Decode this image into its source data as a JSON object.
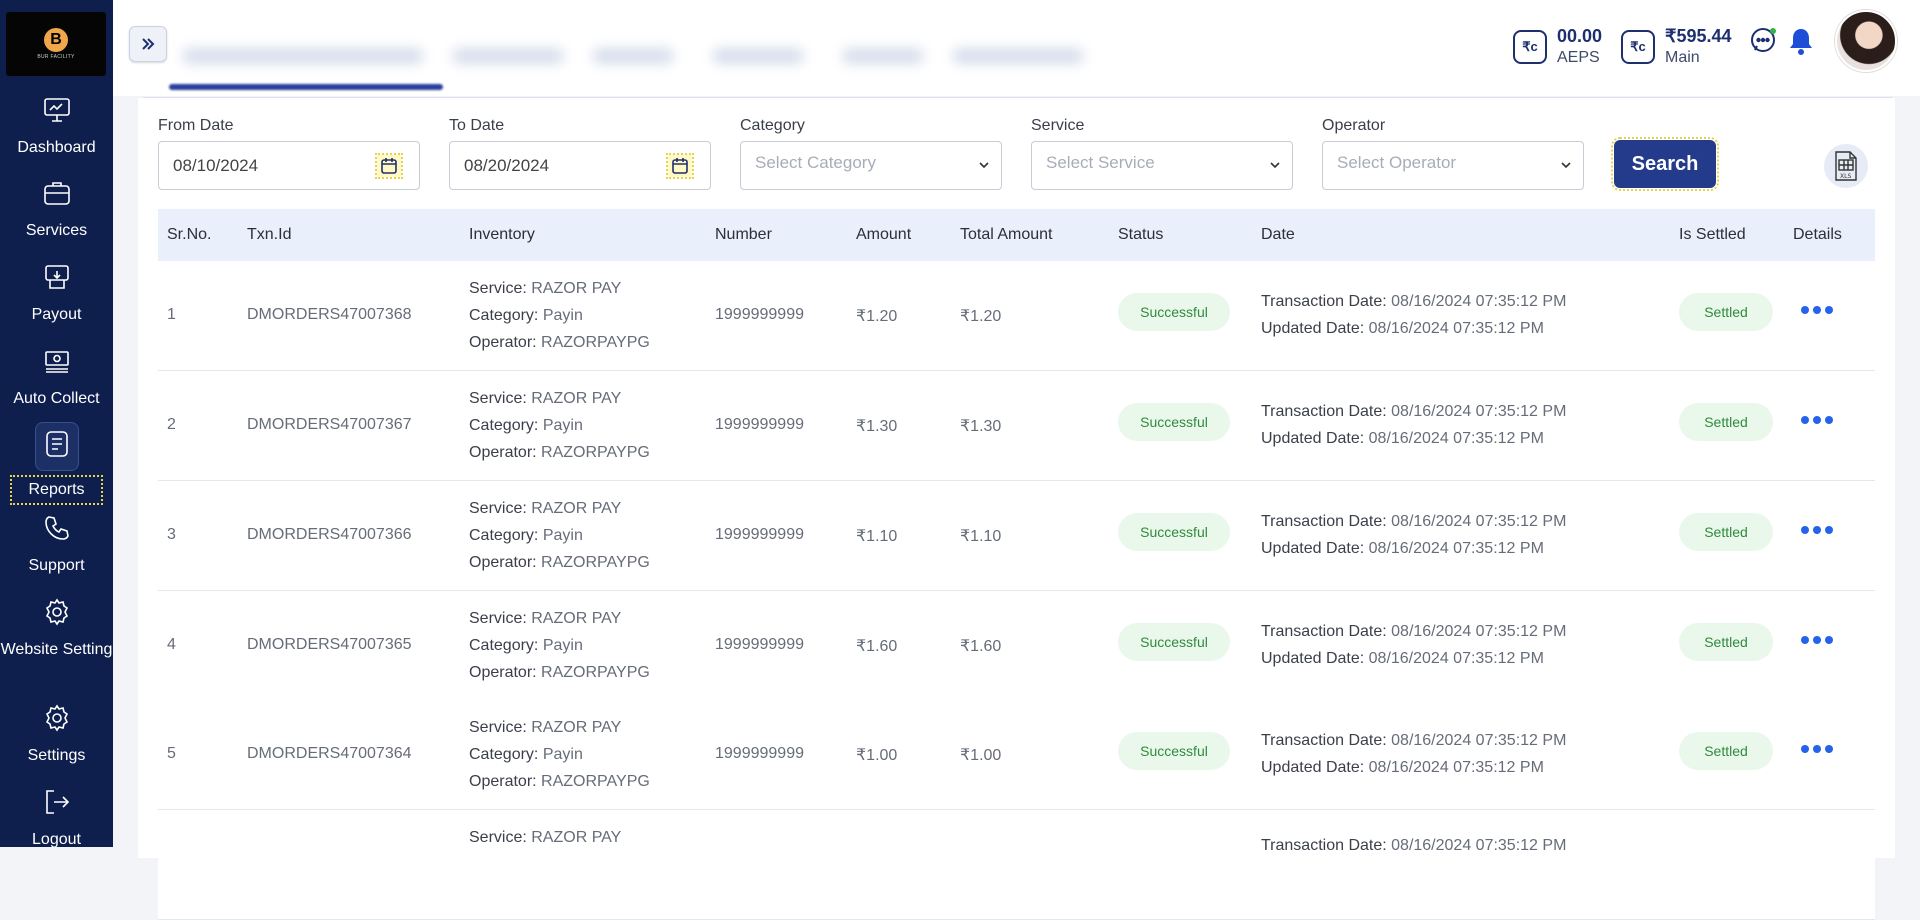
{
  "sidebar": {
    "logo_text": "B",
    "logo_subtext": "BUR FACILITY",
    "items": [
      {
        "label": "Dashboard",
        "icon": "dashboard-icon"
      },
      {
        "label": "Services",
        "icon": "briefcase-icon"
      },
      {
        "label": "Payout",
        "icon": "payout-icon"
      },
      {
        "label": "Auto Collect",
        "icon": "auto-collect-icon"
      },
      {
        "label": "Reports",
        "icon": "reports-icon",
        "active": true
      },
      {
        "label": "Support",
        "icon": "phone-icon"
      },
      {
        "label": "Website Setting",
        "icon": "gear-icon"
      },
      {
        "label": "Settings",
        "icon": "gear-icon"
      },
      {
        "label": "Logout",
        "icon": "logout-icon"
      }
    ]
  },
  "header": {
    "wallets": [
      {
        "amount": "00.00",
        "label": "AEPS",
        "icon": "rupee-wallet-icon"
      },
      {
        "amount": "₹595.44",
        "label": "Main",
        "icon": "rupee-wallet-icon"
      }
    ]
  },
  "filters": {
    "from_date": {
      "label": "From Date",
      "value": "08/10/2024"
    },
    "to_date": {
      "label": "To Date",
      "value": "08/20/2024"
    },
    "category": {
      "label": "Category",
      "placeholder": "Select Category"
    },
    "service": {
      "label": "Service",
      "placeholder": "Select Service"
    },
    "operator": {
      "label": "Operator",
      "placeholder": "Select Operator"
    },
    "search_label": "Search"
  },
  "table": {
    "columns": [
      "Sr.No.",
      "Txn.Id",
      "Inventory",
      "Number",
      "Amount",
      "Total Amount",
      "Status",
      "Date",
      "Is Settled",
      "Details"
    ],
    "labels": {
      "service": "Service:",
      "category": "Category:",
      "operator": "Operator:",
      "txn_date": "Transaction Date:",
      "upd_date": "Updated Date:"
    },
    "rows": [
      {
        "sr": "1",
        "txn": "DMORDERS47007368",
        "service": "RAZOR PAY",
        "category": "Payin",
        "operator": "RAZORPAYPG",
        "number": "1999999999",
        "amount": "₹1.20",
        "total": "₹1.20",
        "status": "Successful",
        "txn_date": "08/16/2024 07:35:12 PM",
        "upd_date": "08/16/2024 07:35:12 PM",
        "settled": "Settled"
      },
      {
        "sr": "2",
        "txn": "DMORDERS47007367",
        "service": "RAZOR PAY",
        "category": "Payin",
        "operator": "RAZORPAYPG",
        "number": "1999999999",
        "amount": "₹1.30",
        "total": "₹1.30",
        "status": "Successful",
        "txn_date": "08/16/2024 07:35:12 PM",
        "upd_date": "08/16/2024 07:35:12 PM",
        "settled": "Settled"
      },
      {
        "sr": "3",
        "txn": "DMORDERS47007366",
        "service": "RAZOR PAY",
        "category": "Payin",
        "operator": "RAZORPAYPG",
        "number": "1999999999",
        "amount": "₹1.10",
        "total": "₹1.10",
        "status": "Successful",
        "txn_date": "08/16/2024 07:35:12 PM",
        "upd_date": "08/16/2024 07:35:12 PM",
        "settled": "Settled"
      },
      {
        "sr": "4",
        "txn": "DMORDERS47007365",
        "service": "RAZOR PAY",
        "category": "Payin",
        "operator": "RAZORPAYPG",
        "number": "1999999999",
        "amount": "₹1.60",
        "total": "₹1.60",
        "status": "Successful",
        "txn_date": "08/16/2024 07:35:12 PM",
        "upd_date": "08/16/2024 07:35:12 PM",
        "settled": "Settled"
      },
      {
        "sr": "5",
        "txn": "DMORDERS47007364",
        "service": "RAZOR PAY",
        "category": "Payin",
        "operator": "RAZORPAYPG",
        "number": "1999999999",
        "amount": "₹1.00",
        "total": "₹1.00",
        "status": "Successful",
        "txn_date": "08/16/2024 07:35:12 PM",
        "upd_date": "08/16/2024 07:35:12 PM",
        "settled": "Settled"
      },
      {
        "sr": "",
        "txn": "",
        "service": "RAZOR PAY",
        "category": "",
        "operator": "",
        "number": "",
        "amount": "",
        "total": "",
        "status": "",
        "txn_date": "08/16/2024 07:35:12 PM",
        "upd_date": "",
        "settled": ""
      }
    ]
  },
  "colors": {
    "sidebar": "#0f1f4d",
    "primary": "#243b8c",
    "success_bg": "#eaf8ec",
    "success_text": "#2f8a3c",
    "link": "#2563eb"
  }
}
